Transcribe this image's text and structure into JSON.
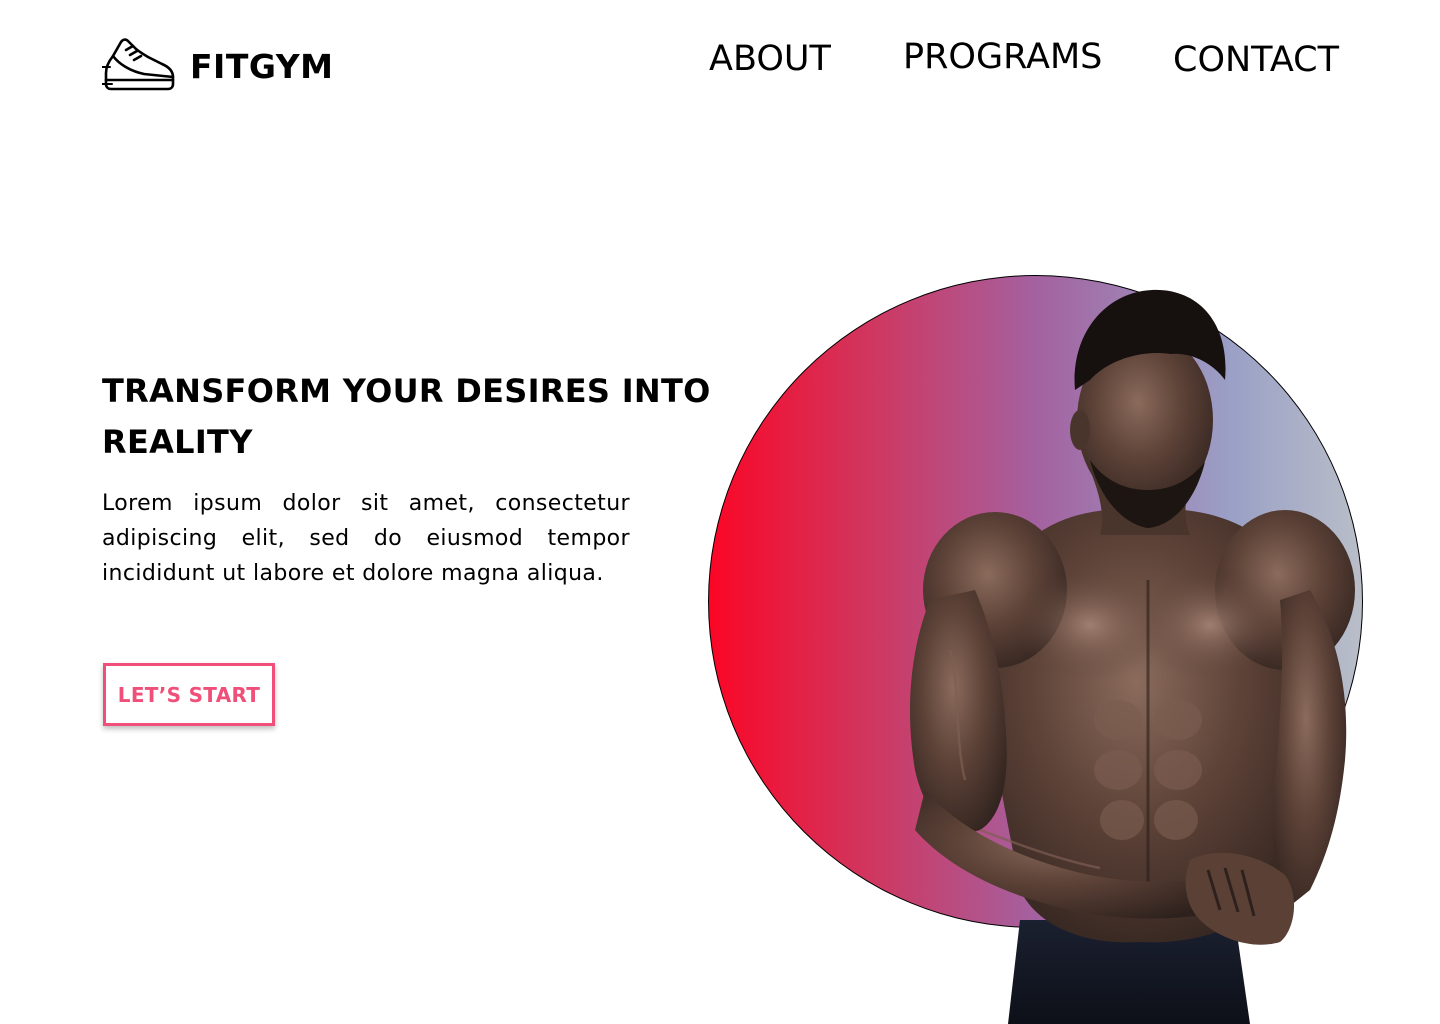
{
  "header": {
    "brand_name": "FITGYM",
    "logo_icon": "sneaker-icon",
    "nav": [
      {
        "label": "ABOUT"
      },
      {
        "label": "PROGRAMS"
      },
      {
        "label": "CONTACT"
      }
    ]
  },
  "hero": {
    "title": "TRANSFORM YOUR DESIRES INTO REALITY",
    "description": "Lorem ipsum dolor sit amet, consectetur adipiscing elit, sed do eiusmod tempor incididunt ut labore et dolore magna aliqua.",
    "cta_label": "LET’S START",
    "gradient_colors": [
      "#fb0626",
      "#a461a0",
      "#b9bec8"
    ],
    "accent_color": "#ef4f78"
  }
}
